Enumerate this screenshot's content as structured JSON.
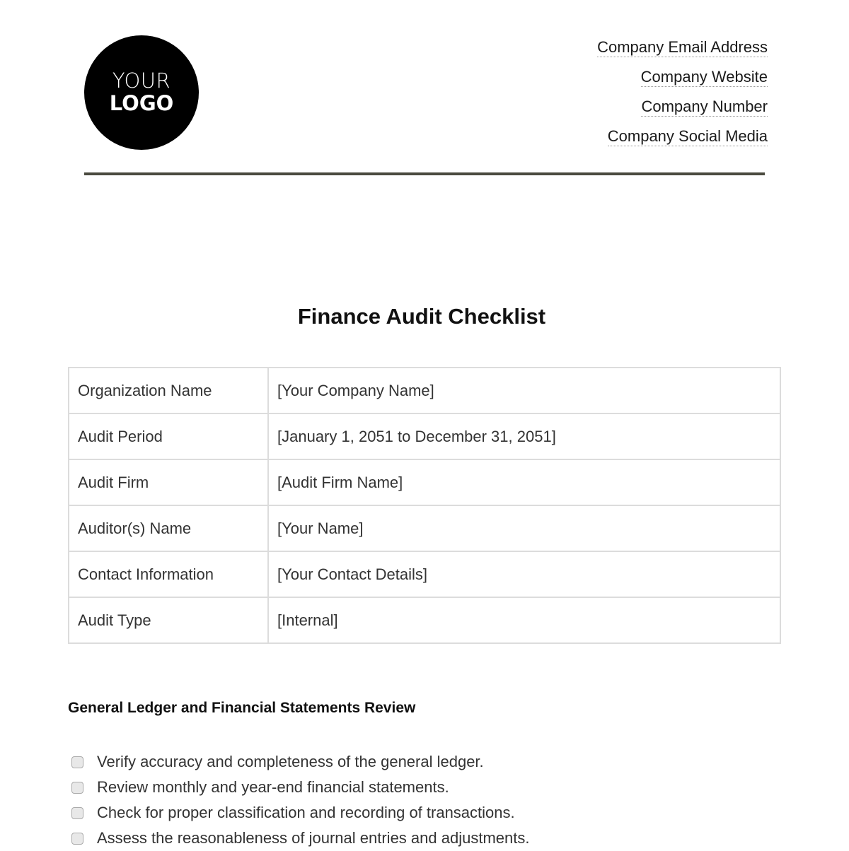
{
  "header": {
    "logo": {
      "line1": "YOUR",
      "line2": "LOGO"
    },
    "contacts": [
      "Company Email Address",
      "Company Website",
      "Company Number",
      "Company Social Media"
    ]
  },
  "document": {
    "title": "Finance Audit Checklist",
    "info_table": [
      {
        "label": "Organization Name",
        "value": "[Your Company Name]"
      },
      {
        "label": "Audit Period",
        "value": "[January 1, 2051 to December 31, 2051]"
      },
      {
        "label": "Audit Firm",
        "value": "[Audit Firm Name]"
      },
      {
        "label": "Auditor(s) Name",
        "value": "[Your Name]"
      },
      {
        "label": "Contact Information",
        "value": "[Your Contact Details]"
      },
      {
        "label": "Audit Type",
        "value": "[Internal]"
      }
    ],
    "sections": [
      {
        "heading": "General Ledger and Financial Statements Review",
        "items": [
          {
            "text": "Verify accuracy and completeness of the general ledger.",
            "checked": false
          },
          {
            "text": "Review monthly and year-end financial statements.",
            "checked": false
          },
          {
            "text": "Check for proper classification and recording of transactions.",
            "checked": false
          },
          {
            "text": "Assess the reasonableness of journal entries and adjustments.",
            "checked": false
          }
        ]
      }
    ]
  }
}
